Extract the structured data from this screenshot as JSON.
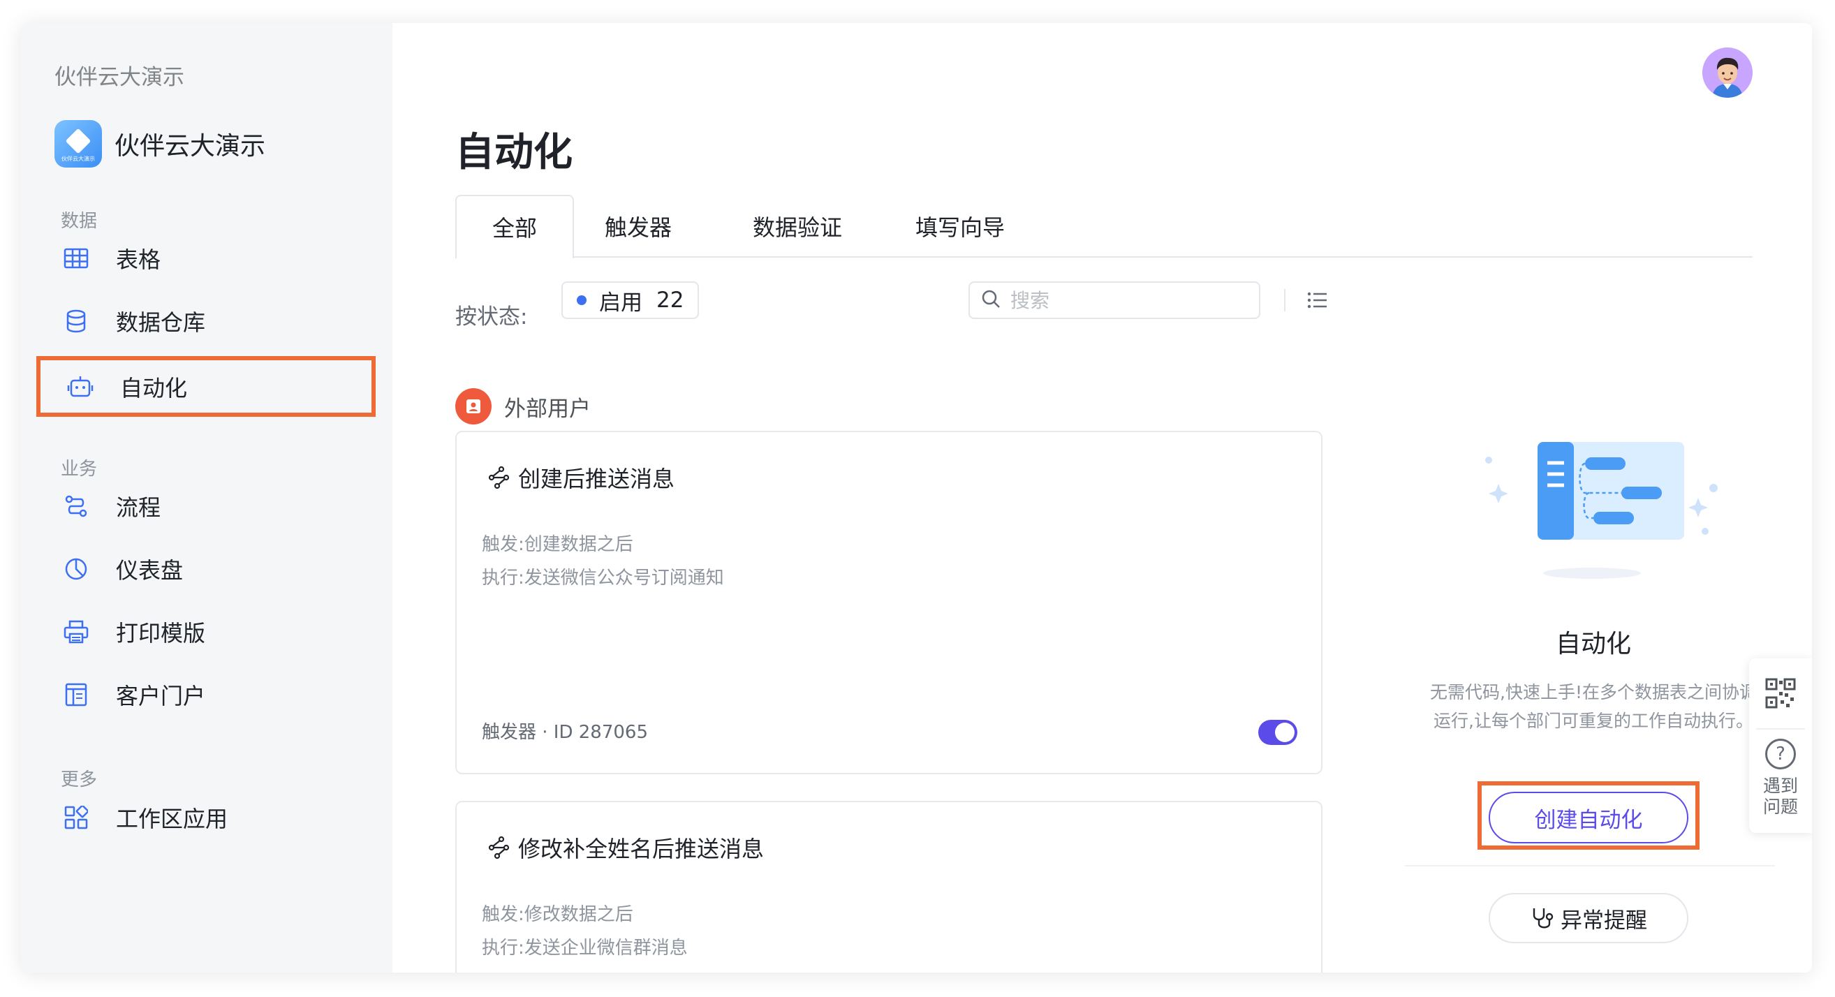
{
  "sidebar": {
    "workspace_title": "伙伴云大演示",
    "app_logo_text": "伙伴云大演示",
    "app_name": "伙伴云大演示",
    "sections": {
      "data": "数据",
      "business": "业务",
      "more": "更多"
    },
    "items": {
      "table": "表格",
      "warehouse": "数据仓库",
      "automation": "自动化",
      "flow": "流程",
      "dashboard": "仪表盘",
      "print": "打印模版",
      "portal": "客户门户",
      "workspace_apps": "工作区应用"
    }
  },
  "main": {
    "title": "自动化",
    "tabs": [
      "全部",
      "触发器",
      "数据验证",
      "填写向导"
    ],
    "filter": {
      "label": "按状态:",
      "status_label": "启用",
      "status_count": "22",
      "status_color": "#3d6ff2"
    },
    "search": {
      "placeholder": "搜索"
    },
    "group": {
      "name": "外部用户",
      "color": "#f05a3c"
    },
    "cards": [
      {
        "title": "创建后推送消息",
        "trigger": "触发:创建数据之后",
        "action": "执行:发送微信公众号订阅通知",
        "footer": "触发器 · ID 287065",
        "enabled": true
      },
      {
        "title": "修改补全姓名后推送消息",
        "trigger": "触发:修改数据之后",
        "action": "执行:发送企业微信群消息"
      }
    ]
  },
  "promo": {
    "title": "自动化",
    "description": "无需代码,快速上手!在多个数据表之间协调运行,让每个部门可重复的工作自动执行。",
    "create_button": "创建自动化",
    "alert_button": "异常提醒",
    "accent_color": "#5b4be9"
  },
  "helper": {
    "question_text": "遇到\n问题"
  },
  "highlight_color": "#ee6b35"
}
